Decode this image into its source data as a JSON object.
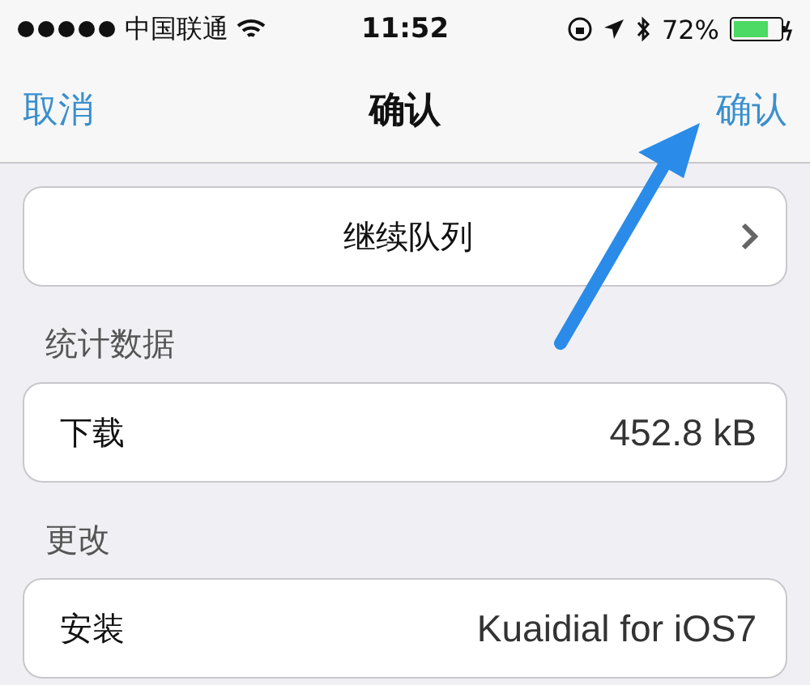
{
  "status_bar": {
    "carrier": "中国联通",
    "time": "11:52",
    "battery": "72%"
  },
  "nav_bar": {
    "left": "取消",
    "title": "确认",
    "right": "确认"
  },
  "sections": [
    {
      "rows": [
        {
          "kind": "link",
          "label": "继续队列"
        }
      ]
    },
    {
      "header": "统计数据",
      "rows": [
        {
          "kind": "value",
          "label": "下载",
          "value": "452.8 kB"
        }
      ]
    },
    {
      "header": "更改",
      "rows": [
        {
          "kind": "value",
          "label": "安装",
          "value": "Kuaidial for iOS7"
        }
      ]
    }
  ]
}
